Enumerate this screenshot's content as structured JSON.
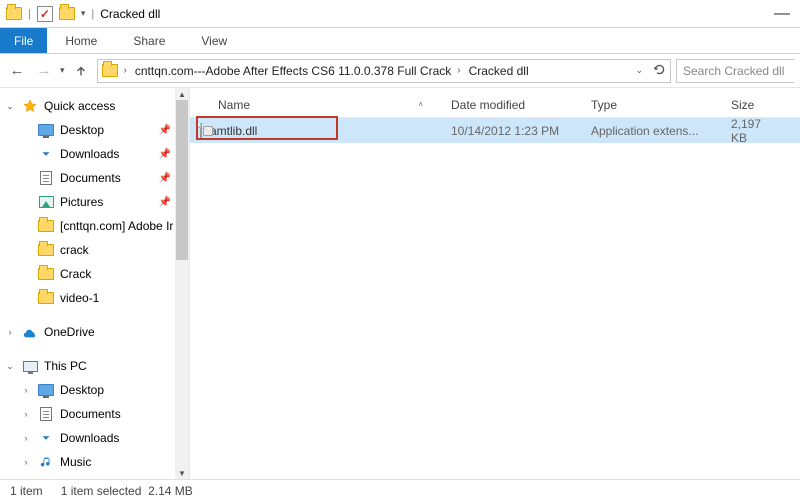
{
  "titlebar": {
    "title": "Cracked dll"
  },
  "ribbon": {
    "file": "File",
    "tabs": [
      "Home",
      "Share",
      "View"
    ]
  },
  "address": {
    "crumbs": [
      "cnttqn.com---Adobe After Effects CS6 11.0.0.378 Full Crack",
      "Cracked dll"
    ],
    "search_placeholder": "Search Cracked dll"
  },
  "sidebar": {
    "quick_access": "Quick access",
    "quick_items": [
      {
        "label": "Desktop",
        "icon": "desktop",
        "pinned": true
      },
      {
        "label": "Downloads",
        "icon": "dl",
        "pinned": true
      },
      {
        "label": "Documents",
        "icon": "doc",
        "pinned": true
      },
      {
        "label": "Pictures",
        "icon": "pic",
        "pinned": true
      },
      {
        "label": "[cnttqn.com] Adobe Ir",
        "icon": "folder",
        "pinned": false
      },
      {
        "label": "crack",
        "icon": "folder",
        "pinned": false
      },
      {
        "label": "Crack",
        "icon": "folder",
        "pinned": false
      },
      {
        "label": "video-1",
        "icon": "folder",
        "pinned": false
      }
    ],
    "onedrive": "OneDrive",
    "thispc": "This PC",
    "pc_items": [
      {
        "label": "Desktop",
        "icon": "desktop"
      },
      {
        "label": "Documents",
        "icon": "doc"
      },
      {
        "label": "Downloads",
        "icon": "dl"
      },
      {
        "label": "Music",
        "icon": "music"
      }
    ]
  },
  "columns": {
    "name": "Name",
    "date": "Date modified",
    "type": "Type",
    "size": "Size"
  },
  "files": [
    {
      "name": "amtlib.dll",
      "date": "10/14/2012 1:23 PM",
      "type": "Application extens...",
      "size": "2,197 KB",
      "selected": true,
      "highlighted": true
    }
  ],
  "status": {
    "count": "1 item",
    "selected": "1 item selected",
    "size": "2.14 MB"
  }
}
